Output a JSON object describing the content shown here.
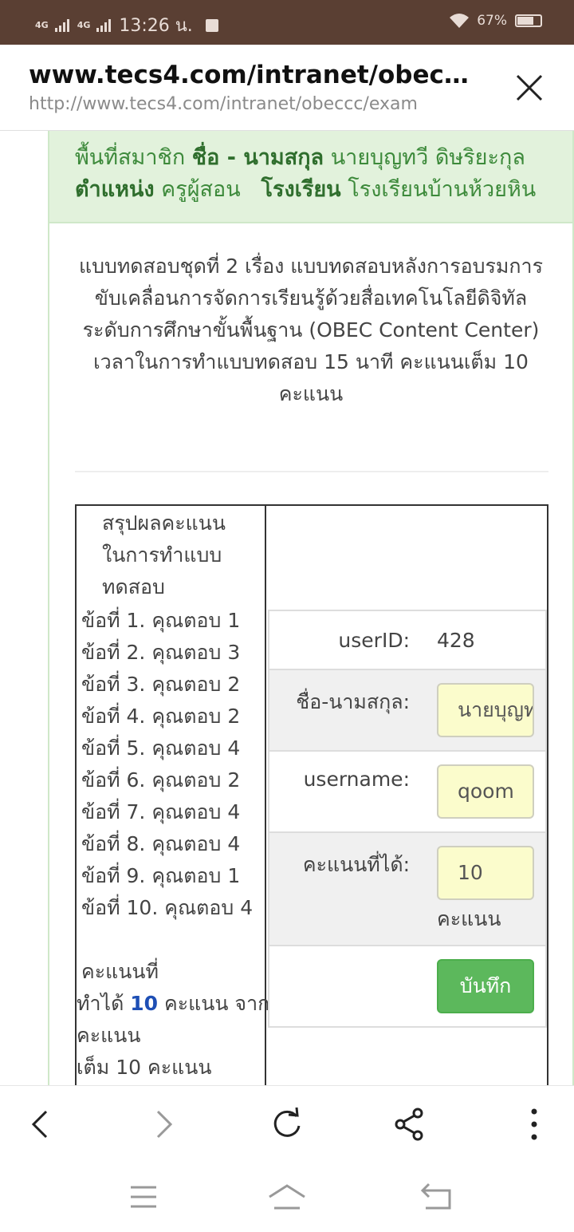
{
  "status_bar": {
    "signal1": "4G",
    "signal2": "4G",
    "time": "13:26 น.",
    "battery": "67%"
  },
  "browser": {
    "title": "www.tecs4.com/intranet/obeccc/exam",
    "url": "http://www.tecs4.com/intranet/obeccc/exam"
  },
  "member": {
    "area_label": "พื้นที่สมาชิก",
    "name_label": "ชื่อ - นามสกุล",
    "name_value": "นายบุญทวี ดิษริยะกุล",
    "position_label": "ตำแหน่ง",
    "position_value": "ครูผู้สอน",
    "school_label": "โรงเรียน",
    "school_value": "โรงเรียนบ้านห้วยหิน"
  },
  "exam": {
    "title": "แบบทดสอบชุดที่ 2 เรื่อง แบบทดสอบหลังการอบรมการขับเคลื่อนการจัดการเรียนรู้ด้วยสื่อเทคโนโลยีดิจิทัล ระดับการศึกษาขั้นพื้นฐาน (OBEC Content Center)",
    "time_info": "เวลาในการทำแบบทดสอบ 15 นาที คะแนนเต็ม 10 คะแนน"
  },
  "summary": {
    "heading": "สรุปผลคะแนนในการทำแบบทดสอบ",
    "answers": [
      "ข้อที่ 1. คุณตอบ 1",
      "ข้อที่ 2. คุณตอบ 3",
      "ข้อที่ 3. คุณตอบ 2",
      "ข้อที่ 4. คุณตอบ 2",
      "ข้อที่ 5. คุณตอบ 4",
      "ข้อที่ 6. คุณตอบ 2",
      "ข้อที่ 7. คุณตอบ 4",
      "ข้อที่ 8. คุณตอบ 4",
      "ข้อที่ 9. คุณตอบ 1",
      "ข้อที่ 10. คุณตอบ 4"
    ],
    "score_prefix_1": "คะแนนที่",
    "score_prefix_2": "ทำได้",
    "score_value": "10",
    "score_suffix": "คะแนน จาก",
    "score_line3": "คะแนน",
    "score_line4": "เต็ม 10 คะแนน"
  },
  "form": {
    "userid_label": "userID:",
    "userid_value": "428",
    "fullname_label": "ชื่อ-นามสกุล:",
    "fullname_value": "นายบุญทวี ดิษริยะกุล",
    "username_label": "username:",
    "username_value": "qoom",
    "score_label": "คะแนนที่ได้:",
    "score_value": "10",
    "score_unit": "คะแนน",
    "save_label": "บันทึก"
  },
  "colors": {
    "accent_green": "#5cb85c",
    "member_bg": "#e2f2dc",
    "status_bar": "#5a3f33",
    "score_blue": "#1e4fb5"
  }
}
